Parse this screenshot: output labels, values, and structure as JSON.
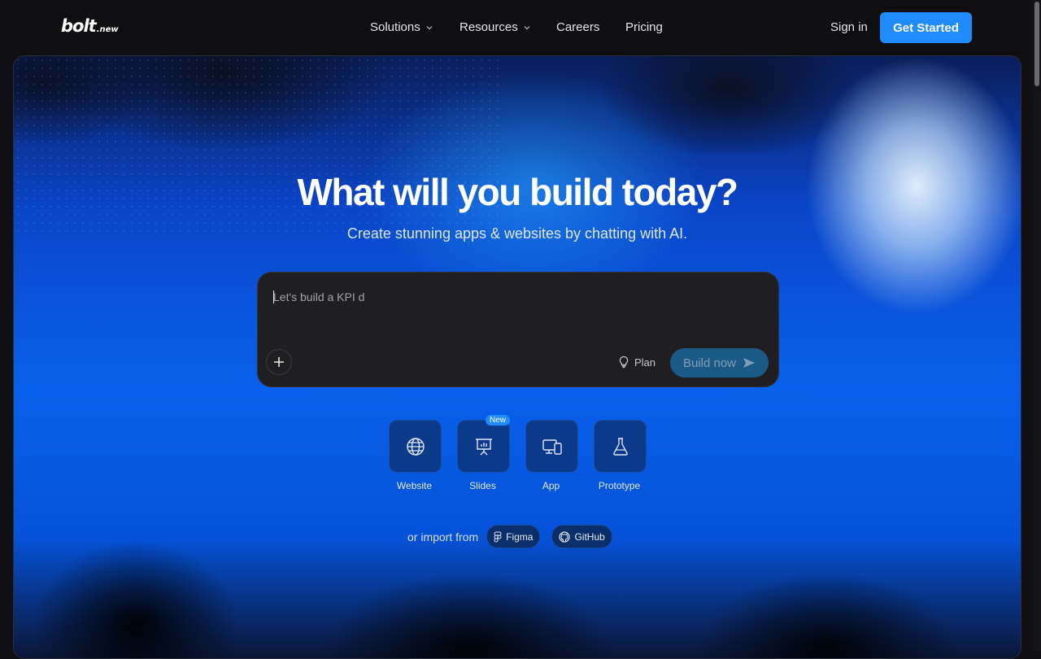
{
  "header": {
    "logo_main": "bolt",
    "logo_suffix": ".new",
    "nav": [
      {
        "label": "Solutions",
        "has_dropdown": true
      },
      {
        "label": "Resources",
        "has_dropdown": true
      },
      {
        "label": "Careers",
        "has_dropdown": false
      },
      {
        "label": "Pricing",
        "has_dropdown": false
      }
    ],
    "sign_in": "Sign in",
    "get_started": "Get Started"
  },
  "hero": {
    "title": "What will you build today?",
    "subtitle": "Create stunning apps & websites by chatting with AI."
  },
  "prompt": {
    "value": "Let's build a KPI d",
    "plan_label": "Plan",
    "build_label": "Build now"
  },
  "types": [
    {
      "label": "Website",
      "icon": "globe-icon"
    },
    {
      "label": "Slides",
      "icon": "presentation-icon",
      "badge": "New"
    },
    {
      "label": "App",
      "icon": "devices-icon"
    },
    {
      "label": "Prototype",
      "icon": "flask-icon"
    }
  ],
  "import": {
    "label": "or import from",
    "figma": "Figma",
    "github": "GitHub"
  },
  "colors": {
    "accent": "#1f8bff",
    "background": "#0f0f11"
  }
}
